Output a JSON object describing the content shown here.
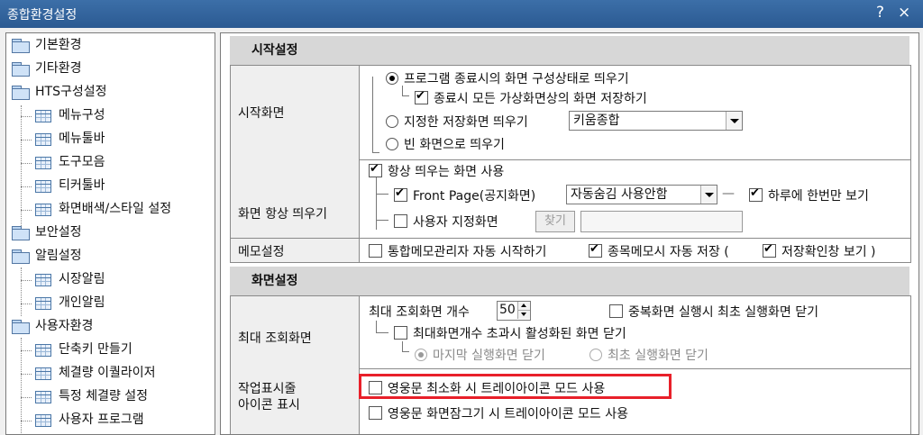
{
  "window": {
    "title": "종합환경설정",
    "help_label": "?",
    "close_label": "×"
  },
  "tree": {
    "items": [
      {
        "label": "기본환경",
        "type": "folder"
      },
      {
        "label": "기타환경",
        "type": "folder"
      },
      {
        "label": "HTS구성설정",
        "type": "folder"
      },
      {
        "label": "메뉴구성",
        "type": "item"
      },
      {
        "label": "메뉴툴바",
        "type": "item"
      },
      {
        "label": "도구모음",
        "type": "item"
      },
      {
        "label": "티커툴바",
        "type": "item"
      },
      {
        "label": "화면배색/스타일 설정",
        "type": "item"
      },
      {
        "label": "보안설정",
        "type": "folder"
      },
      {
        "label": "알림설정",
        "type": "folder"
      },
      {
        "label": "시장알림",
        "type": "item"
      },
      {
        "label": "개인알림",
        "type": "item"
      },
      {
        "label": "사용자환경",
        "type": "folder"
      },
      {
        "label": "단축키 만들기",
        "type": "item"
      },
      {
        "label": "체결량 이퀄라이저",
        "type": "item"
      },
      {
        "label": "특정 체결량 설정",
        "type": "item"
      },
      {
        "label": "사용자 프로그램",
        "type": "item"
      }
    ]
  },
  "start_section": {
    "title": "시작설정",
    "start_screen": {
      "label": "시작화면",
      "opt_restore": "프로그램 종료시의 화면 구성상태로 띄우기",
      "opt_save_on_exit": "종료시 모든 가상화면상의 화면 저장하기",
      "opt_saved_screen": "지정한 저장화면 띄우기",
      "saved_screen_value": "키움종합",
      "opt_blank": "빈 화면으로 띄우기"
    },
    "always_on": {
      "label": "화면 항상 띄우기",
      "use_always": "항상 띄우는 화면 사용",
      "front_page": "Front Page(공지화면)",
      "front_page_value": "자동숨김 사용안함",
      "dash": "—",
      "once_a_day": "하루에 한번만 보기",
      "user_defined": "사용자 지정화면",
      "find_button": "찾기"
    },
    "memo": {
      "label": "메모설정",
      "auto_start": "통합메모관리자 자동 시작하기",
      "auto_save": "종목메모시 자동 저장 (",
      "confirm": "저장확인창 보기 )"
    }
  },
  "screen_section": {
    "title": "화면설정",
    "max_screens": {
      "label": "최대 조회화면",
      "count_label": "최대 조회화면 개수",
      "count_value": "50",
      "close_duplicate": "중복화면 실행시 최초 실행화면 닫기",
      "close_on_exceed": "최대화면개수 초과시 활성화된 화면 닫기",
      "close_last": "마지막 실행화면 닫기",
      "close_first": "최초 실행화면 닫기"
    },
    "tray": {
      "label": "작업표시줄\n아이콘 표시",
      "minimize_tray": "영웅문 최소화 시 트레이아이콘 모드 사용",
      "lock_tray": "영웅문 화면잠그기 시 트레이아이콘 모드 사용"
    }
  },
  "colors": {
    "highlight": "#e8202a",
    "titlebar": "#2b5a92"
  }
}
